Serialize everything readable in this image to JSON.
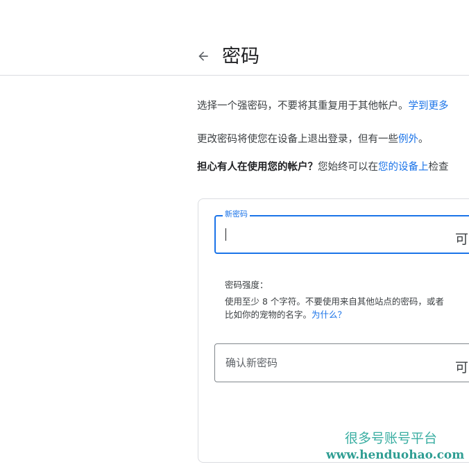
{
  "header": {
    "title": "密码",
    "back_icon": "arrow-left-icon"
  },
  "intro": {
    "line1_text": "选择一个强密码，不要将其重复用于其他帐户。",
    "line1_link": "学到更多",
    "line2_text": "更改密码将使您在设备上退出登录，但有一些",
    "line2_link": "例外",
    "line2_end": "。",
    "line3_bold": "担心有人在使用您的帐户？",
    "line3_text": "您始终可以在",
    "line3_link": "您的设备上",
    "line3_end": "检查"
  },
  "form": {
    "new_password_label": "新密码",
    "new_password_value": "",
    "visibility_toggle": "可",
    "strength_title": "密码强度：",
    "strength_line1": "使用至少 8 个字符。不要使用来自其他站点的密码，或者",
    "strength_line2": "比如你的宠物的名字。",
    "strength_link": "为什么？",
    "confirm_password_placeholder": "确认新密码",
    "confirm_visibility_toggle": "可"
  },
  "watermark": {
    "chinese": "很多号账号平台",
    "url": "www.henduohao.com"
  },
  "colors": {
    "accent": "#1a73e8",
    "text": "#3c4043",
    "divider": "#dadce0",
    "watermark": "#3aaea2"
  }
}
